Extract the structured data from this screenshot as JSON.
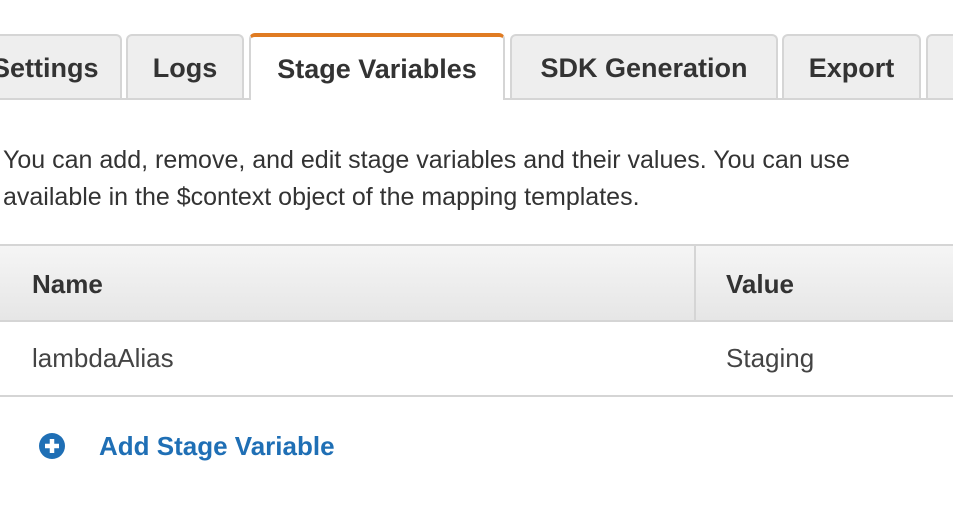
{
  "tabs": [
    {
      "label": "Settings",
      "active": false
    },
    {
      "label": "Logs",
      "active": false
    },
    {
      "label": "Stage Variables",
      "active": true
    },
    {
      "label": "SDK Generation",
      "active": false
    },
    {
      "label": "Export",
      "active": false
    },
    {
      "label": "",
      "active": false
    }
  ],
  "description": {
    "line1": "You can add, remove, and edit stage variables and their values. You can use",
    "line2": "available in the $context object of the mapping templates."
  },
  "table": {
    "columns": [
      "Name",
      "Value"
    ],
    "rows": [
      {
        "name": "lambdaAlias",
        "value": "Staging"
      }
    ]
  },
  "add_variable": {
    "label": "Add Stage Variable",
    "icon": "plus-circle-icon"
  },
  "colors": {
    "active_tab_accent": "#e07b22",
    "link": "#1f6fb5"
  }
}
